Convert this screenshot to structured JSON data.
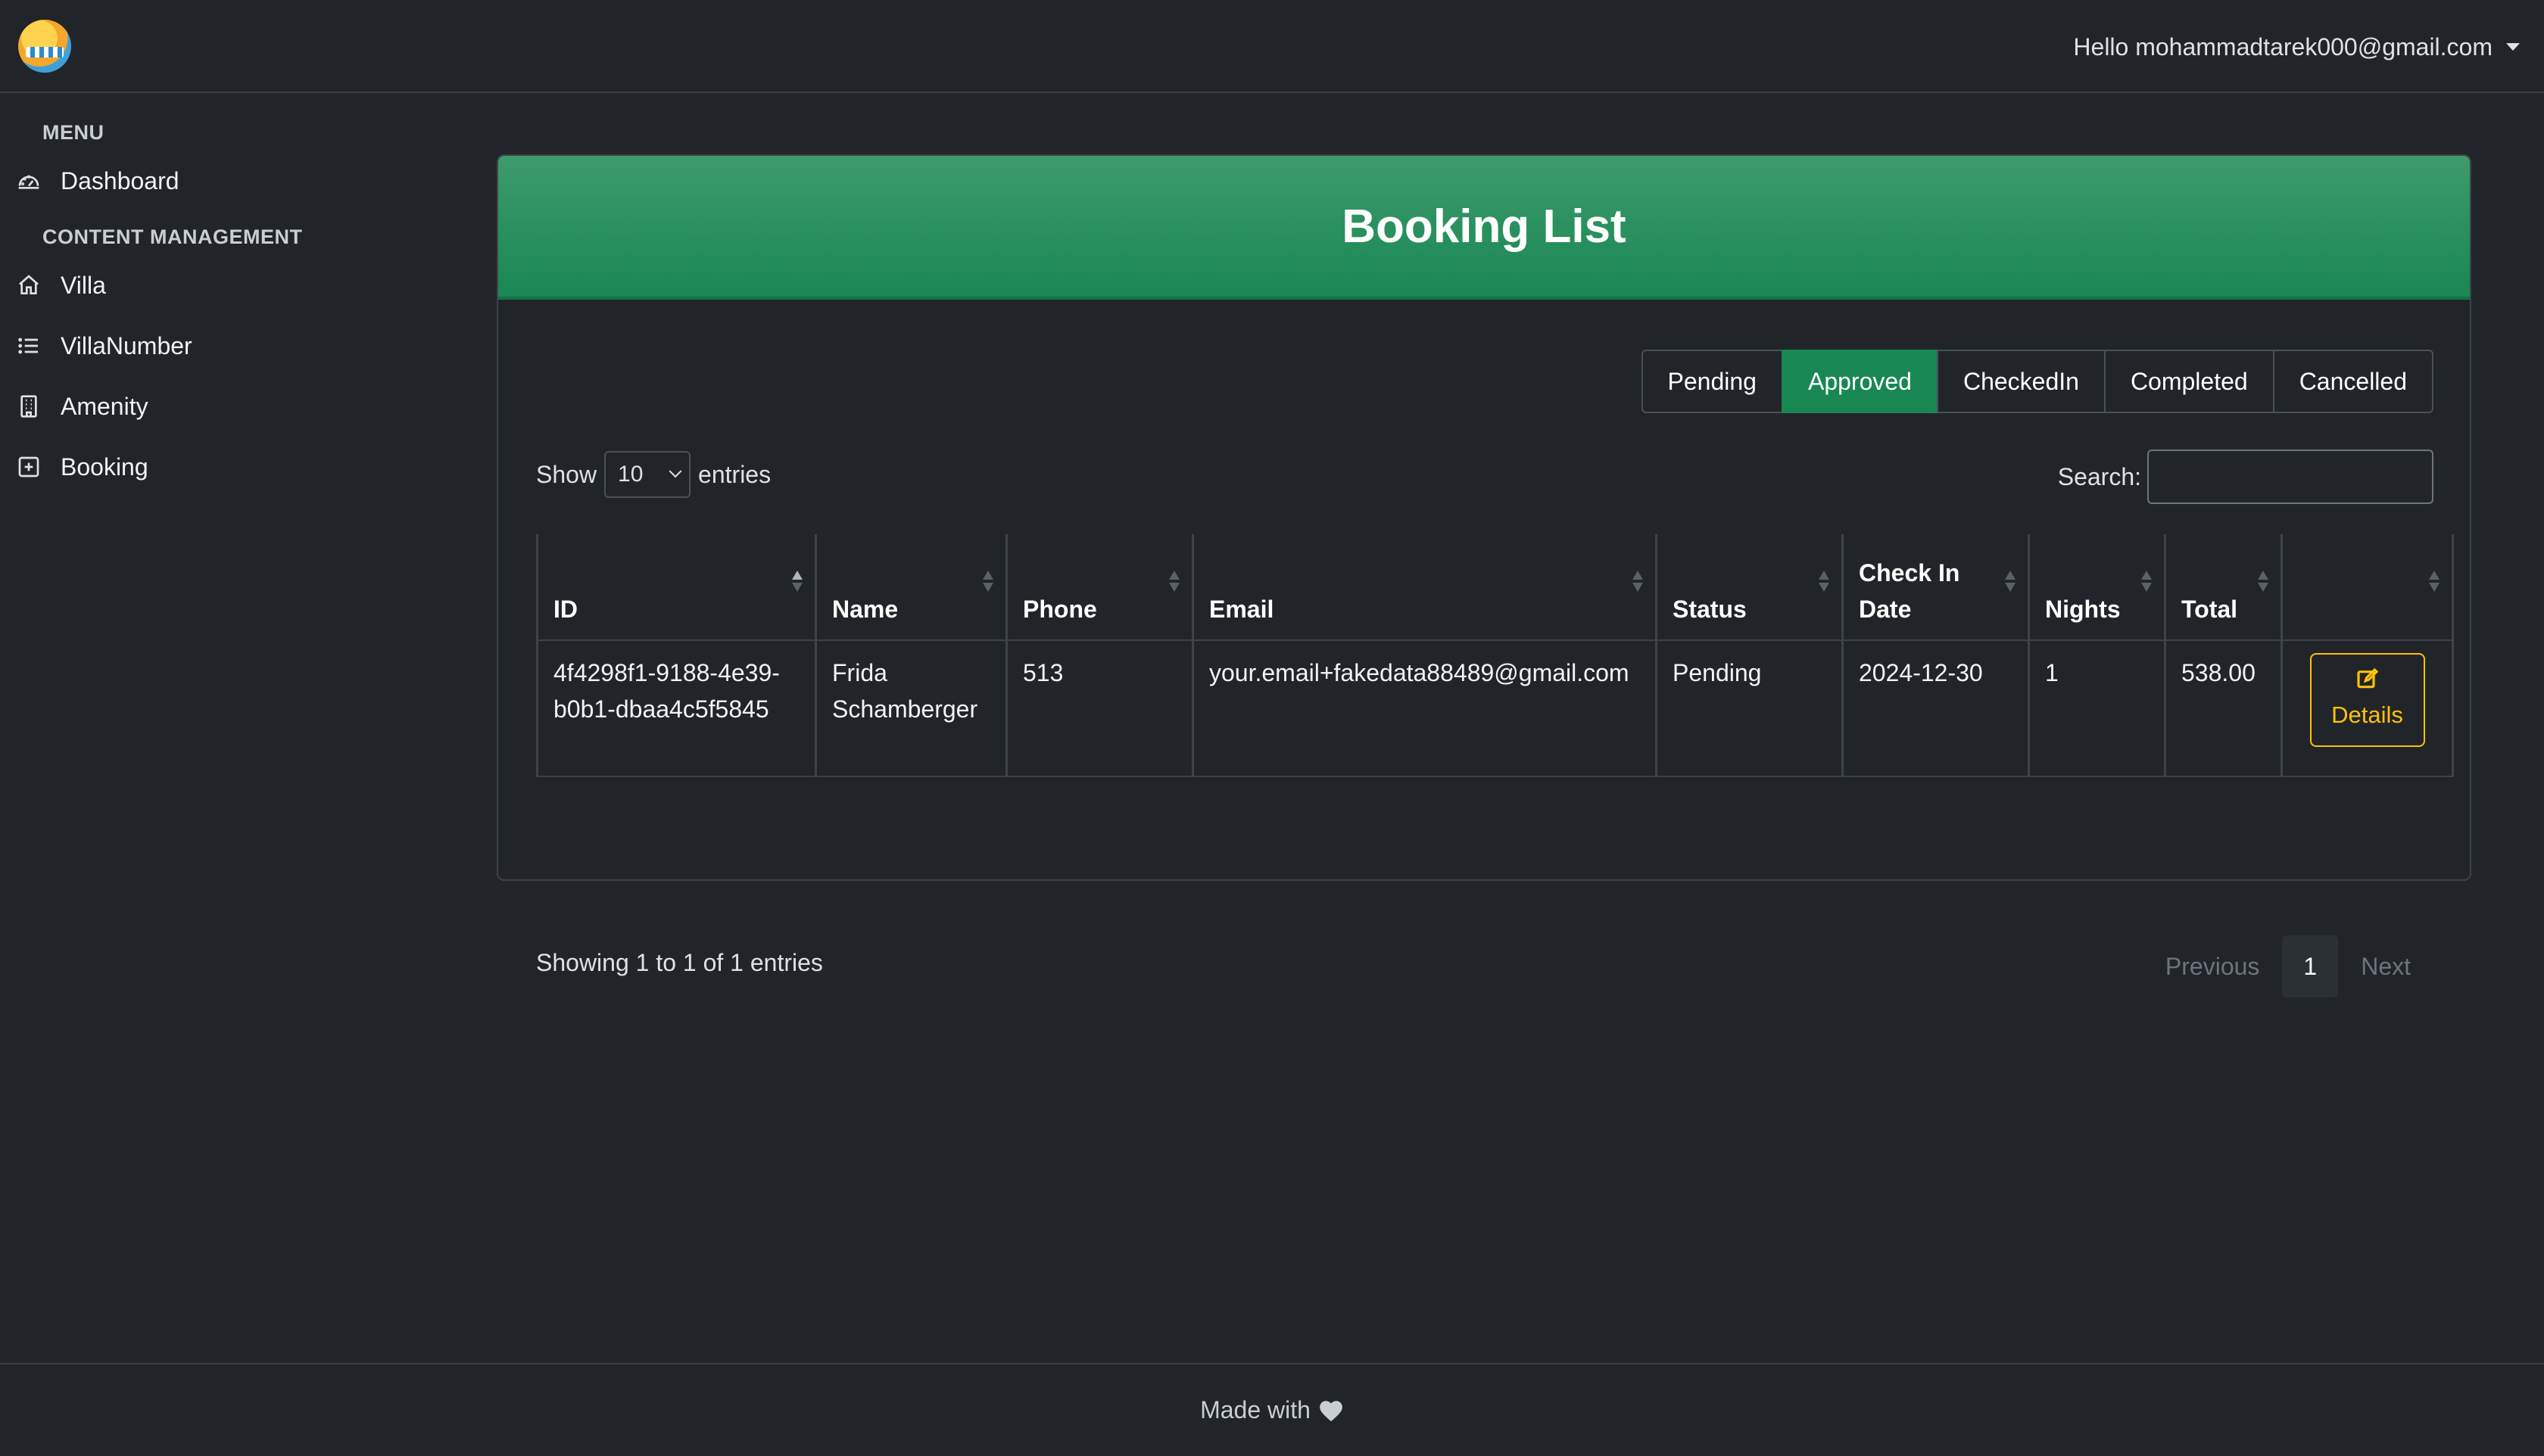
{
  "header": {
    "user_greeting": "Hello mohammadtarek000@gmail.com"
  },
  "sidebar": {
    "menu_title": "MENU",
    "content_title": "CONTENT MANAGEMENT",
    "items": [
      {
        "label": "Dashboard",
        "icon": "dashboard-gauge-icon"
      },
      {
        "label": "Villa",
        "icon": "house-icon"
      },
      {
        "label": "VillaNumber",
        "icon": "list-icon"
      },
      {
        "label": "Amenity",
        "icon": "building-icon"
      },
      {
        "label": "Booking",
        "icon": "plus-square-icon"
      }
    ]
  },
  "card": {
    "title": "Booking List"
  },
  "filters": [
    {
      "label": "Pending",
      "active": false
    },
    {
      "label": "Approved",
      "active": true
    },
    {
      "label": "CheckedIn",
      "active": false
    },
    {
      "label": "Completed",
      "active": false
    },
    {
      "label": "Cancelled",
      "active": false
    }
  ],
  "length": {
    "show_label": "Show",
    "value": "10",
    "entries_label": "entries"
  },
  "search": {
    "label": "Search:",
    "value": ""
  },
  "table": {
    "columns": [
      "ID",
      "Name",
      "Phone",
      "Email",
      "Status",
      "Check In Date",
      "Nights",
      "Total",
      ""
    ],
    "rows": [
      {
        "id": "4f4298f1-9188-4e39-b0b1-dbaa4c5f5845",
        "name": "Frida Schamberger",
        "phone": "513",
        "email": "your.email+fakedata88489@gmail.com",
        "status": "Pending",
        "check_in": "2024-12-30",
        "nights": "1",
        "total": "538.00",
        "action": "Details"
      }
    ]
  },
  "info": "Showing 1 to 1 of 1 entries",
  "pagination": {
    "previous": "Previous",
    "current": "1",
    "next": "Next"
  },
  "footer": {
    "text": "Made with"
  },
  "colors": {
    "background": "#212529",
    "accent": "#198754",
    "warning": "#ffc107"
  }
}
